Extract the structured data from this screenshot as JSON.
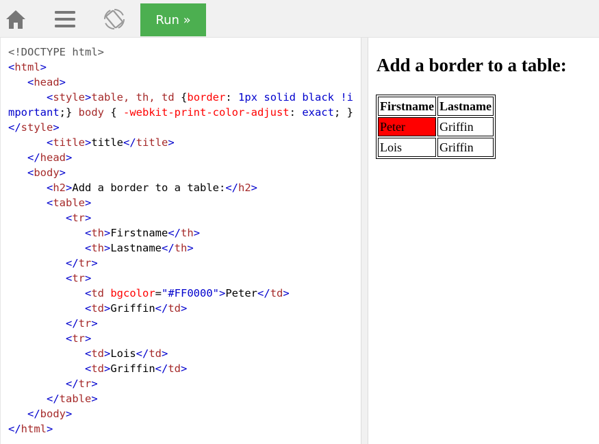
{
  "toolbar": {
    "icons": [
      "home-icon",
      "menu-icon",
      "rotate-icon"
    ],
    "run_label": "Run »",
    "run_color": "#4caf50"
  },
  "code": {
    "doctype": "<!DOCTYPE html>",
    "style_rule": "table, th, td {border: 1px solid black !important;} body { -webkit-print-color-adjust: exact; }",
    "title": "title",
    "h2": "Add a border to a table:",
    "th1": "Firstname",
    "th2": "Lastname",
    "bgcolor": "\"#FF0000\"",
    "td1": "Peter",
    "td2": "Griffin",
    "td3": "Lois",
    "td4": "Griffin"
  },
  "result": {
    "heading": "Add a border to a table:",
    "headers": [
      "Firstname",
      "Lastname"
    ],
    "rows": [
      {
        "first": "Peter",
        "last": "Griffin",
        "first_bg": "#FF0000"
      },
      {
        "first": "Lois",
        "last": "Griffin"
      }
    ]
  }
}
